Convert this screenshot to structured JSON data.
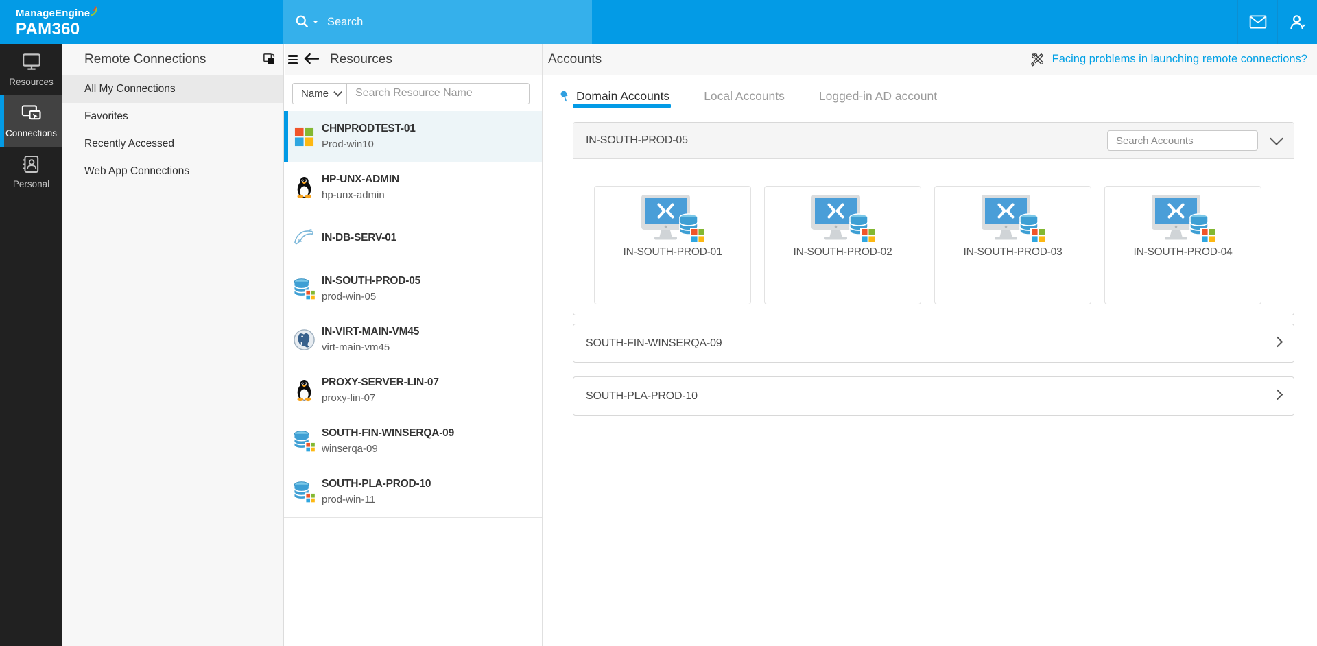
{
  "topbar": {
    "brand_line1": "ManageEngine",
    "brand_line2": "PAM360",
    "search_placeholder": "Search"
  },
  "sidebar": {
    "items": [
      {
        "label": "Resources",
        "icon": "monitor-icon",
        "active": false
      },
      {
        "label": "Connections",
        "icon": "connections-icon",
        "active": true
      },
      {
        "label": "Personal",
        "icon": "personal-book-icon",
        "active": false
      }
    ]
  },
  "connections_panel": {
    "title": "Remote Connections",
    "items": [
      {
        "label": "All My Connections",
        "active": true
      },
      {
        "label": "Favorites",
        "active": false
      },
      {
        "label": "Recently Accessed",
        "active": false
      },
      {
        "label": "Web App Connections",
        "active": false
      }
    ]
  },
  "resources_panel": {
    "title": "Resources",
    "filter_label": "Name",
    "search_placeholder": "Search Resource Name",
    "items": [
      {
        "name": "CHNPRODTEST-01",
        "sub": "Prod-win10",
        "icon": "windows-icon",
        "selected": true
      },
      {
        "name": "HP-UNX-ADMIN",
        "sub": "hp-unx-admin",
        "icon": "linux-tux-icon",
        "selected": false
      },
      {
        "name": "IN-DB-SERV-01",
        "sub": "",
        "icon": "mysql-dolphin-icon",
        "selected": false
      },
      {
        "name": "IN-SOUTH-PROD-05",
        "sub": "prod-win-05",
        "icon": "database-windows-icon",
        "selected": false
      },
      {
        "name": "IN-VIRT-MAIN-VM45",
        "sub": "virt-main-vm45",
        "icon": "postgresql-icon",
        "selected": false
      },
      {
        "name": "PROXY-SERVER-LIN-07",
        "sub": "proxy-lin-07",
        "icon": "linux-tux-icon",
        "selected": false
      },
      {
        "name": "SOUTH-FIN-WINSERQA-09",
        "sub": "winserqa-09",
        "icon": "database-windows-icon",
        "selected": false
      },
      {
        "name": "SOUTH-PLA-PROD-10",
        "sub": "prod-win-11",
        "icon": "database-windows-icon",
        "selected": false
      }
    ]
  },
  "accounts": {
    "title": "Accounts",
    "help_link": "Facing problems in launching remote connections?",
    "tabs": [
      {
        "label": "Domain Accounts",
        "active": true,
        "pinned": true
      },
      {
        "label": "Local Accounts",
        "active": false
      },
      {
        "label": "Logged-in AD account",
        "active": false
      }
    ],
    "groups": [
      {
        "name": "IN-SOUTH-PROD-05",
        "expanded": true,
        "search_placeholder": "Search Accounts",
        "accounts": [
          {
            "name": "IN-SOUTH-PROD-01"
          },
          {
            "name": "IN-SOUTH-PROD-02"
          },
          {
            "name": "IN-SOUTH-PROD-03"
          },
          {
            "name": "IN-SOUTH-PROD-04"
          }
        ]
      },
      {
        "name": "SOUTH-FIN-WINSERQA-09",
        "expanded": false
      },
      {
        "name": "SOUTH-PLA-PROD-10",
        "expanded": false
      }
    ]
  }
}
